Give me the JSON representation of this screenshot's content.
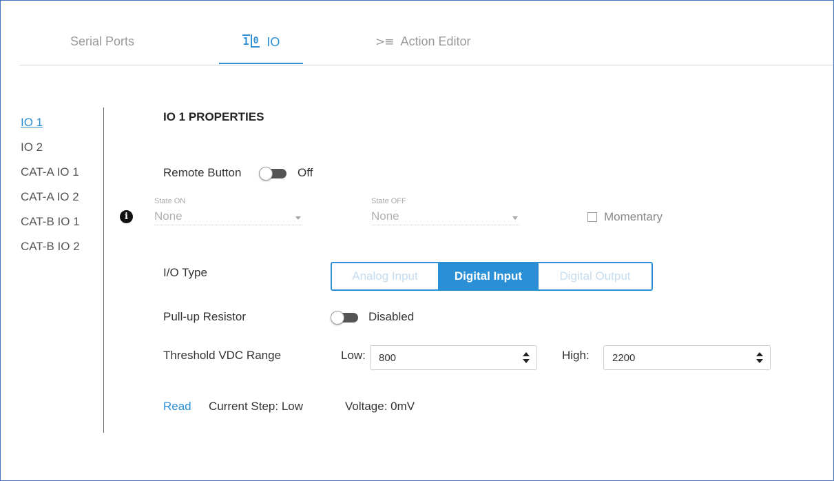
{
  "tabs": [
    {
      "label": "Serial Ports",
      "icon": ""
    },
    {
      "label": "IO",
      "icon": "io-icon",
      "active": true
    },
    {
      "label": "Action Editor",
      "icon": "action-editor-icon"
    }
  ],
  "sidebar": {
    "items": [
      {
        "label": "IO 1",
        "active": true
      },
      {
        "label": "IO 2"
      },
      {
        "label": "CAT-A IO 1"
      },
      {
        "label": "CAT-A IO 2"
      },
      {
        "label": "CAT-B IO 1"
      },
      {
        "label": "CAT-B IO 2"
      }
    ]
  },
  "main": {
    "title": "IO 1 PROPERTIES",
    "remote_button": {
      "label": "Remote Button",
      "state": "Off"
    },
    "state_on": {
      "caption": "State ON",
      "value": "None"
    },
    "state_off": {
      "caption": "State OFF",
      "value": "None"
    },
    "momentary": {
      "label": "Momentary",
      "checked": false
    },
    "io_type": {
      "label": "I/O Type",
      "options": [
        "Analog Input",
        "Digital Input",
        "Digital Output"
      ],
      "selected": "Digital Input"
    },
    "pullup": {
      "label": "Pull-up Resistor",
      "state": "Disabled"
    },
    "threshold": {
      "label": "Threshold VDC Range",
      "low_label": "Low:",
      "low_value": "800",
      "high_label": "High:",
      "high_value": "2200"
    },
    "read": {
      "link": "Read",
      "current_step": "Current Step: Low",
      "voltage": "Voltage: 0mV"
    }
  },
  "colors": {
    "accent": "#2b8fd6",
    "frame": "#4472c4"
  }
}
